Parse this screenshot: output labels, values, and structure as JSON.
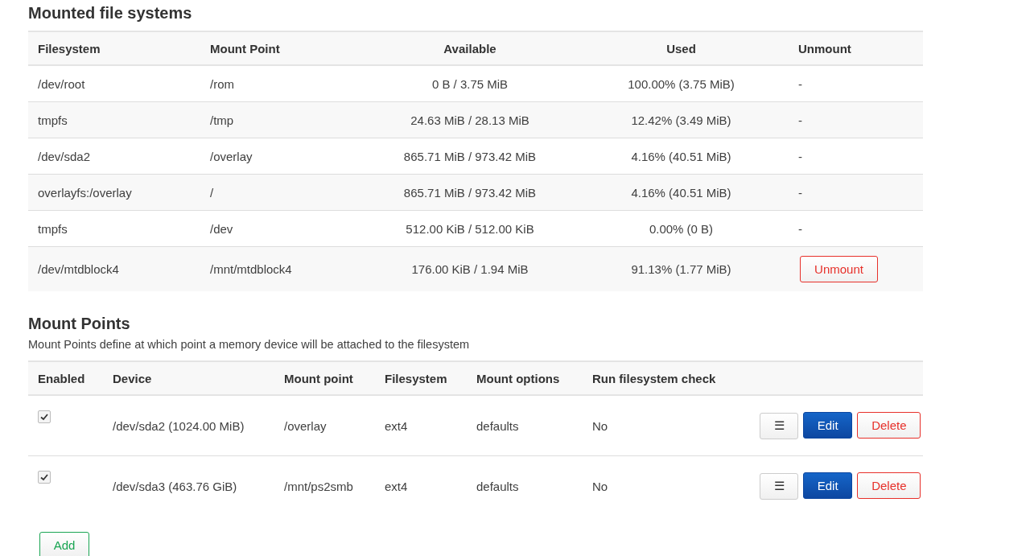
{
  "mounted": {
    "title": "Mounted file systems",
    "columns": [
      "Filesystem",
      "Mount Point",
      "Available",
      "Used",
      "Unmount"
    ],
    "rows": [
      {
        "filesystem": "/dev/root",
        "mount_point": "/rom",
        "available": "0 B / 3.75 MiB",
        "used": "100.00% (3.75 MiB)",
        "unmount": {
          "kind": "text",
          "label": "-"
        }
      },
      {
        "filesystem": "tmpfs",
        "mount_point": "/tmp",
        "available": "24.63 MiB / 28.13 MiB",
        "used": "12.42% (3.49 MiB)",
        "unmount": {
          "kind": "text",
          "label": "-"
        }
      },
      {
        "filesystem": "/dev/sda2",
        "mount_point": "/overlay",
        "available": "865.71 MiB / 973.42 MiB",
        "used": "4.16% (40.51 MiB)",
        "unmount": {
          "kind": "text",
          "label": "-"
        }
      },
      {
        "filesystem": "overlayfs:/overlay",
        "mount_point": "/",
        "available": "865.71 MiB / 973.42 MiB",
        "used": "4.16% (40.51 MiB)",
        "unmount": {
          "kind": "text",
          "label": "-"
        }
      },
      {
        "filesystem": "tmpfs",
        "mount_point": "/dev",
        "available": "512.00 KiB / 512.00 KiB",
        "used": "0.00% (0 B)",
        "unmount": {
          "kind": "text",
          "label": "-"
        }
      },
      {
        "filesystem": "/dev/mtdblock4",
        "mount_point": "/mnt/mtdblock4",
        "available": "176.00 KiB / 1.94 MiB",
        "used": "91.13% (1.77 MiB)",
        "unmount": {
          "kind": "button",
          "label": "Unmount"
        }
      }
    ]
  },
  "mount_points": {
    "title": "Mount Points",
    "description": "Mount Points define at which point a memory device will be attached to the filesystem",
    "columns": [
      "Enabled",
      "Device",
      "Mount point",
      "Filesystem",
      "Mount options",
      "Run filesystem check"
    ],
    "rows": [
      {
        "enabled": true,
        "device": "/dev/sda2 (1024.00 MiB)",
        "mount_point": "/overlay",
        "filesystem": "ext4",
        "options": "defaults",
        "check": "No",
        "menu": "☰",
        "edit": "Edit",
        "delete": "Delete"
      },
      {
        "enabled": true,
        "device": "/dev/sda3 (463.76 GiB)",
        "mount_point": "/mnt/ps2smb",
        "filesystem": "ext4",
        "options": "defaults",
        "check": "No",
        "menu": "☰",
        "edit": "Edit",
        "delete": "Delete"
      }
    ],
    "add": "Add"
  }
}
